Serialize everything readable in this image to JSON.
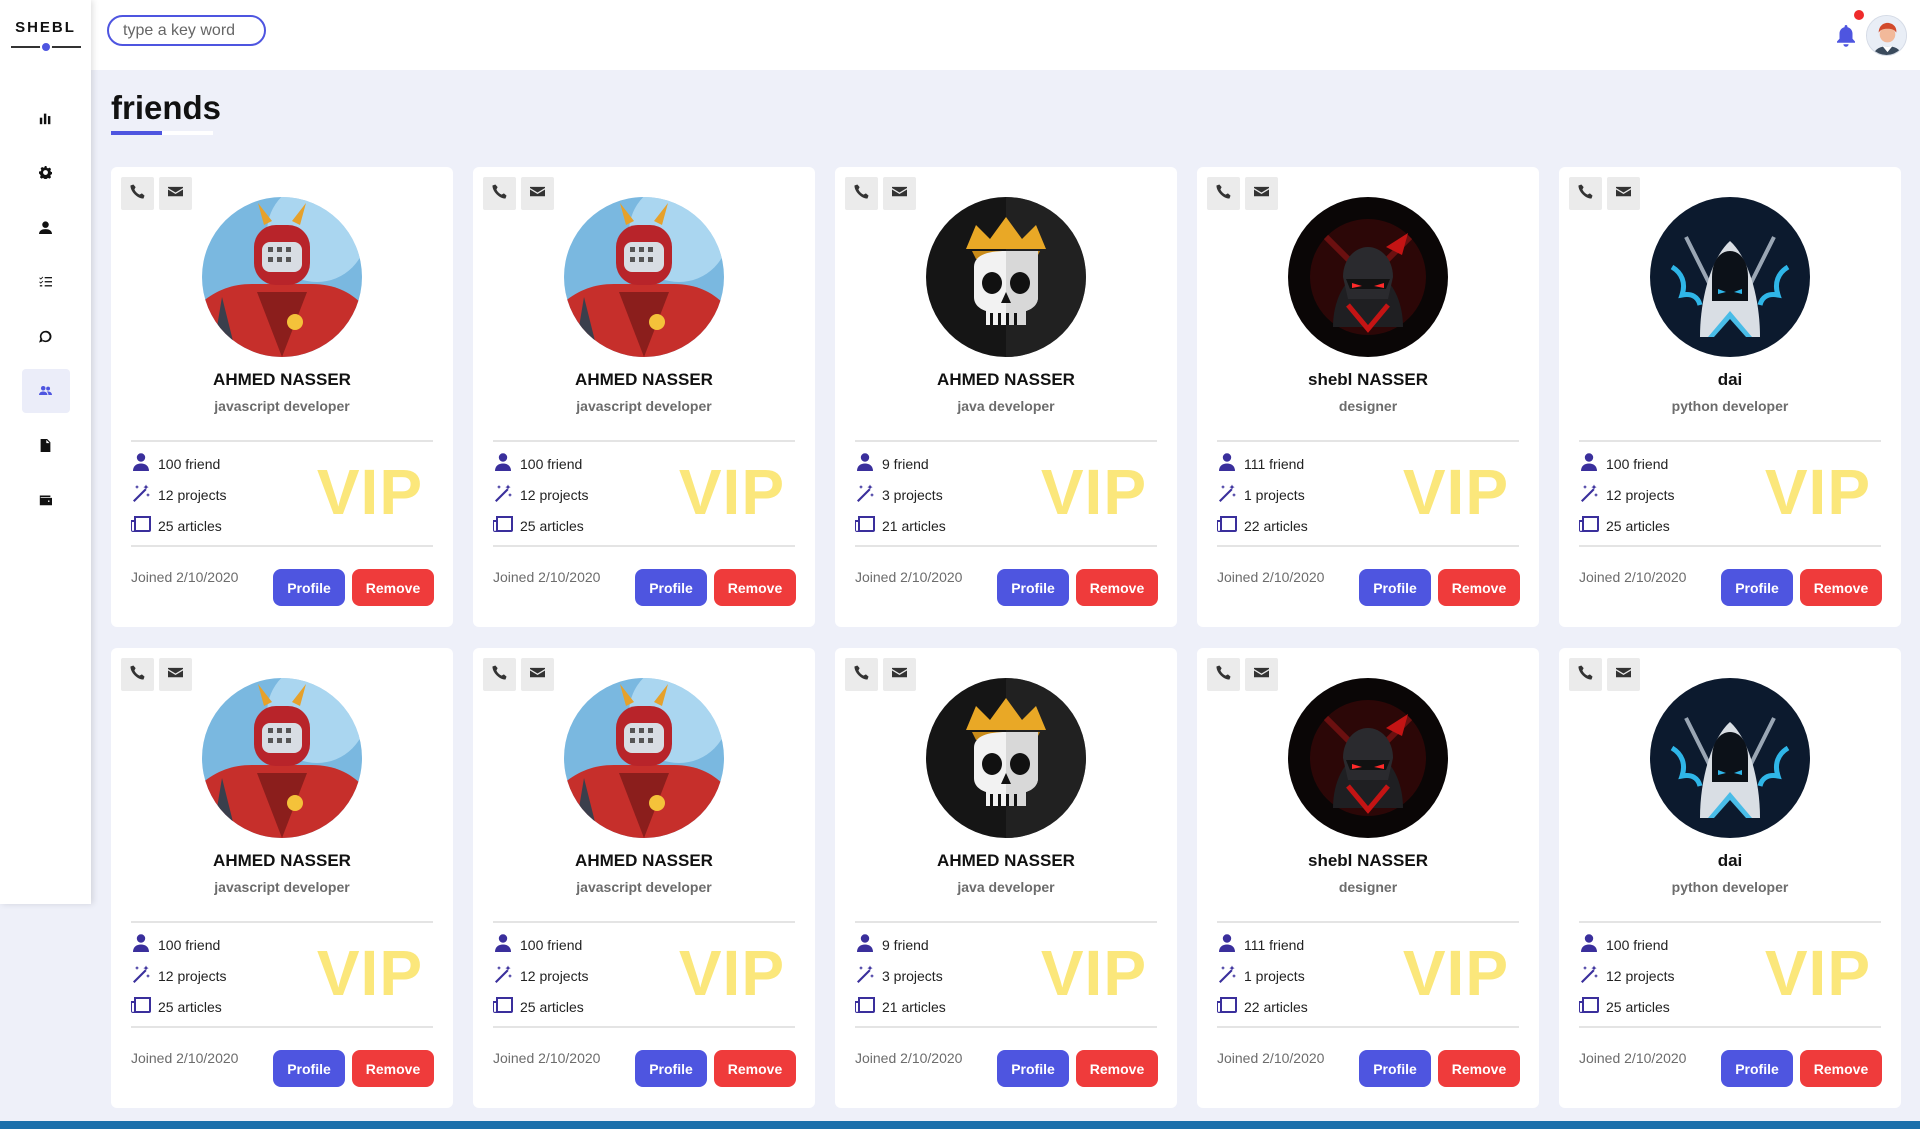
{
  "app": {
    "logo": "SHEBL"
  },
  "sidebar": {
    "items": [
      {
        "icon": "chart-bar-icon",
        "active": false
      },
      {
        "icon": "gear-icon",
        "active": false
      },
      {
        "icon": "user-icon",
        "active": false
      },
      {
        "icon": "task-list-icon",
        "active": false
      },
      {
        "icon": "chat-icon",
        "active": false
      },
      {
        "icon": "users-icon",
        "active": true
      },
      {
        "icon": "file-icon",
        "active": false
      },
      {
        "icon": "wallet-icon",
        "active": false
      }
    ]
  },
  "header": {
    "search_placeholder": "type a key word",
    "has_notification": true
  },
  "page": {
    "title": "friends"
  },
  "labels": {
    "vip": "VIP",
    "profile_button": "Profile",
    "remove_button": "Remove"
  },
  "colors": {
    "accent": "#4e55e0",
    "danger": "#ef3b3b",
    "vip": "#fbe77b",
    "page_bg": "#eef0f9"
  },
  "cards": [
    {
      "avatar": "red-robot-avatar",
      "name": "AHMED NASSER",
      "role": "javascript developer",
      "friends": "100 friend",
      "projects": "12 projects",
      "articles": "25 articles",
      "joined": "Joined 2/10/2020"
    },
    {
      "avatar": "red-robot-avatar",
      "name": "AHMED NASSER",
      "role": "javascript developer",
      "friends": "100 friend",
      "projects": "12 projects",
      "articles": "25 articles",
      "joined": "Joined 2/10/2020"
    },
    {
      "avatar": "crowned-skull-avatar",
      "name": "AHMED NASSER",
      "role": "java developer",
      "friends": "9 friend",
      "projects": "3 projects",
      "articles": "21 articles",
      "joined": "Joined 2/10/2020"
    },
    {
      "avatar": "red-ninja-avatar",
      "name": "shebl NASSER",
      "role": "designer",
      "friends": "111 friend",
      "projects": "1 projects",
      "articles": "22 articles",
      "joined": "Joined 2/10/2020"
    },
    {
      "avatar": "hooded-assassin-avatar",
      "name": "dai",
      "role": "python developer",
      "friends": "100 friend",
      "projects": "12 projects",
      "articles": "25 articles",
      "joined": "Joined 2/10/2020"
    },
    {
      "avatar": "red-robot-avatar",
      "name": "AHMED NASSER",
      "role": "javascript developer",
      "friends": "100 friend",
      "projects": "12 projects",
      "articles": "25 articles",
      "joined": "Joined 2/10/2020"
    },
    {
      "avatar": "red-robot-avatar",
      "name": "AHMED NASSER",
      "role": "javascript developer",
      "friends": "100 friend",
      "projects": "12 projects",
      "articles": "25 articles",
      "joined": "Joined 2/10/2020"
    },
    {
      "avatar": "crowned-skull-avatar",
      "name": "AHMED NASSER",
      "role": "java developer",
      "friends": "9 friend",
      "projects": "3 projects",
      "articles": "21 articles",
      "joined": "Joined 2/10/2020"
    },
    {
      "avatar": "red-ninja-avatar",
      "name": "shebl NASSER",
      "role": "designer",
      "friends": "111 friend",
      "projects": "1 projects",
      "articles": "22 articles",
      "joined": "Joined 2/10/2020"
    },
    {
      "avatar": "hooded-assassin-avatar",
      "name": "dai",
      "role": "python developer",
      "friends": "100 friend",
      "projects": "12 projects",
      "articles": "25 articles",
      "joined": "Joined 2/10/2020"
    }
  ]
}
